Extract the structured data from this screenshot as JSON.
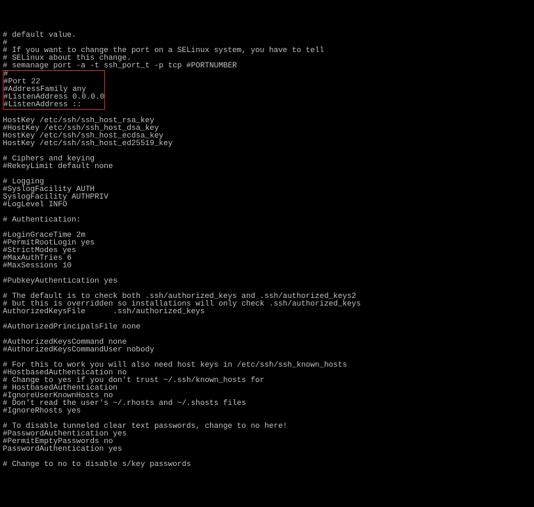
{
  "lines": {
    "l0": "# default value.",
    "l1": "#",
    "l2": "# If you want to change the port on a SELinux system, you have to tell",
    "l3": "# SELinux about this change.",
    "l4": "# semanage port -a -t ssh_port_t -p tcp #PORTNUMBER",
    "h0": "#",
    "h1": "#Port 22",
    "h2": "#AddressFamily any",
    "h3": "#ListenAddress 0.0.0.0",
    "h4": "#ListenAddress ::",
    "l5": "",
    "l6": "HostKey /etc/ssh/ssh_host_rsa_key",
    "l7": "#HostKey /etc/ssh/ssh_host_dsa_key",
    "l8": "HostKey /etc/ssh/ssh_host_ecdsa_key",
    "l9": "HostKey /etc/ssh/ssh_host_ed25519_key",
    "l10": "",
    "l11": "# Ciphers and keying",
    "l12": "#RekeyLimit default none",
    "l13": "",
    "l14": "# Logging",
    "l15": "#SyslogFacility AUTH",
    "l16": "SyslogFacility AUTHPRIV",
    "l17": "#LogLevel INFO",
    "l18": "",
    "l19": "# Authentication:",
    "l20": "",
    "l21": "#LoginGraceTime 2m",
    "l22": "#PermitRootLogin yes",
    "l23": "#StrictModes yes",
    "l24": "#MaxAuthTries 6",
    "l25": "#MaxSessions 10",
    "l26": "",
    "l27": "#PubkeyAuthentication yes",
    "l28": "",
    "l29": "# The default is to check both .ssh/authorized_keys and .ssh/authorized_keys2",
    "l30": "# but this is overridden so installations will only check .ssh/authorized_keys",
    "l31": "AuthorizedKeysFile      .ssh/authorized_keys",
    "l32": "",
    "l33": "#AuthorizedPrincipalsFile none",
    "l34": "",
    "l35": "#AuthorizedKeysCommand none",
    "l36": "#AuthorizedKeysCommandUser nobody",
    "l37": "",
    "l38": "# For this to work you will also need host keys in /etc/ssh/ssh_known_hosts",
    "l39": "#HostbasedAuthentication no",
    "l40": "# Change to yes if you don't trust ~/.ssh/known_hosts for",
    "l41": "# HostbasedAuthentication",
    "l42": "#IgnoreUserKnownHosts no",
    "l43": "# Don't read the user's ~/.rhosts and ~/.shosts files",
    "l44": "#IgnoreRhosts yes",
    "l45": "",
    "l46": "# To disable tunneled clear text passwords, change to no here!",
    "l47": "#PasswordAuthentication yes",
    "l48": "#PermitEmptyPasswords no",
    "l49": "PasswordAuthentication yes",
    "l50": "",
    "l51": "# Change to no to disable s/key passwords"
  }
}
